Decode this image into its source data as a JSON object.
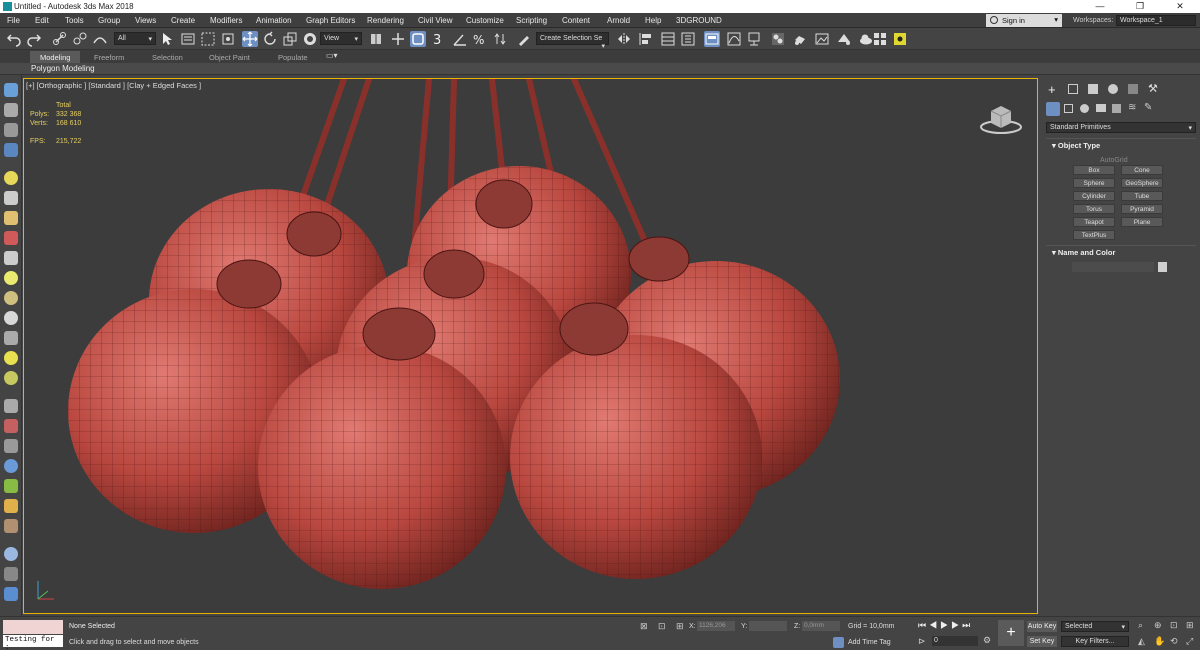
{
  "window": {
    "title": "Untitled - Autodesk 3ds Max 2018",
    "controls": [
      "—",
      "❐",
      "✕"
    ]
  },
  "menubar": {
    "items": [
      "File",
      "Edit",
      "Tools",
      "Group",
      "Views",
      "Create",
      "Modifiers",
      "Animation",
      "Graph Editors",
      "Rendering",
      "Civil View",
      "Customize",
      "Scripting",
      "Content",
      "Arnold",
      "Help",
      "3DGROUND"
    ],
    "signin": "Sign in",
    "workspaces_label": "Workspaces:",
    "workspace": "Workspace_1"
  },
  "toolbar": {
    "filter": "All",
    "view_select": "View",
    "selection_set": "Create Selection Se"
  },
  "ribbon": {
    "tabs": [
      "Modeling",
      "Freeform",
      "Selection",
      "Object Paint",
      "Populate"
    ],
    "subtitle": "Polygon Modeling"
  },
  "viewport": {
    "label": "[+] [Orthographic ] [Standard ] [Clay + Edged Faces ]",
    "stats": {
      "total": "Total",
      "polys_label": "Polys:",
      "polys": "332 368",
      "verts_label": "Verts:",
      "verts": "168 610",
      "fps_label": "FPS:",
      "fps": "215,722"
    }
  },
  "command_panel": {
    "dropdown": "Standard Primitives",
    "object_type": "Object Type",
    "autogrid": "AutoGrid",
    "buttons": [
      "Box",
      "Cone",
      "Sphere",
      "GeoSphere",
      "Cylinder",
      "Tube",
      "Torus",
      "Pyramid",
      "Teapot",
      "Plane",
      "TextPlus"
    ],
    "name_and_color": "Name and Color"
  },
  "status": {
    "maxscript": "Testing for :",
    "selection": "None Selected",
    "prompt": "Click and drag to select and move objects",
    "x_label": "X:",
    "x_value": "1126,206",
    "y_label": "Y:",
    "z_label": "Z:",
    "z_value": "0,0mm",
    "grid": "Grid = 10,0mm",
    "add_time_tag": "Add Time Tag",
    "frame": "0",
    "auto_key": "Auto Key",
    "set_key": "Set Key",
    "selected": "Selected",
    "key_filters": "Key Filters..."
  },
  "colors": {
    "sphere": "#c9514a",
    "viewport_border": "#e8b400",
    "active_tool": "#6d8fc2"
  }
}
